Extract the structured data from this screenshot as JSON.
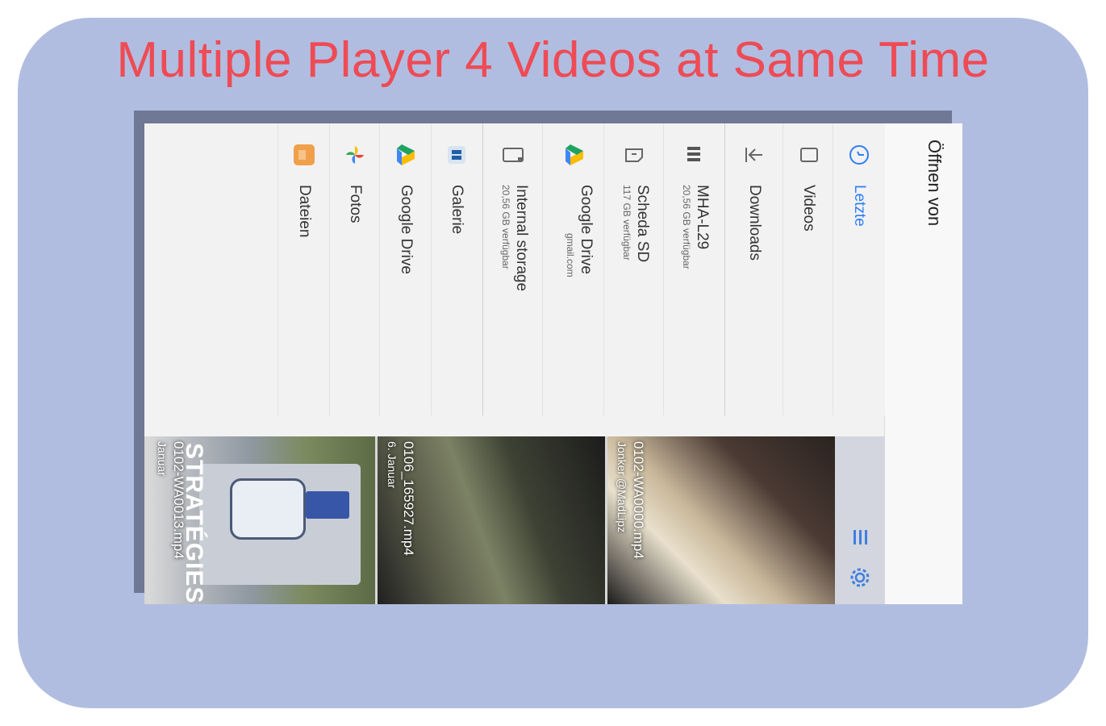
{
  "headline": "Multiple Player 4 Videos at Same Time",
  "picker": {
    "title": "Öffnen von",
    "nav_items": [
      {
        "label": "Letzte",
        "icon": "clock-icon",
        "active": true
      },
      {
        "label": "Videos",
        "icon": "video-icon"
      },
      {
        "label": "Downloads",
        "icon": "download-icon"
      },
      {
        "label": "MHA-L29",
        "sub": "20,56 GB verfügbar",
        "icon": "phone-storage-icon"
      },
      {
        "label": "Scheda SD",
        "sub": "117 GB verfügbar",
        "icon": "sd-card-icon"
      },
      {
        "label": "Google Drive",
        "sub": "gmail.com",
        "icon": "google-drive-icon"
      },
      {
        "label": "Internal storage",
        "sub": "20,56 GB verfügbar",
        "icon": "internal-storage-icon"
      },
      {
        "label": "Galerie",
        "icon": "gallery-icon"
      },
      {
        "label": "Google Drive",
        "icon": "google-drive-icon"
      },
      {
        "label": "Fotos",
        "icon": "photos-pinwheel-icon"
      },
      {
        "label": "Dateien",
        "icon": "files-icon"
      }
    ],
    "videos": [
      {
        "name": "0102-WA0000.mp4",
        "date": "Jonker @MadLipz"
      },
      {
        "name": "0106_165927.mp4",
        "date": "6. Januar"
      },
      {
        "name": "0102-WA0013.mp4",
        "date": "Januar",
        "overlay_text": "STRATÉGIES"
      }
    ],
    "toolbar": {
      "grid_icon": "grid-view-icon",
      "settings_icon": "settings-gear-icon"
    }
  },
  "colors": {
    "accent": "#2f7df6",
    "headline": "#ee4b55",
    "card": "#b1bde0"
  }
}
